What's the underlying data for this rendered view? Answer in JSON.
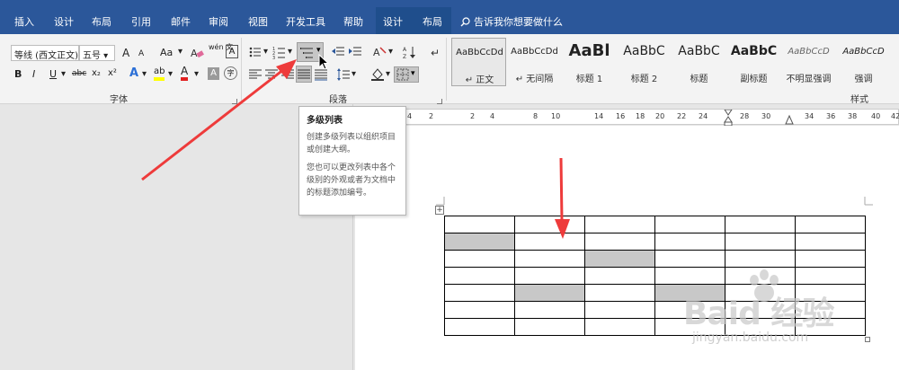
{
  "tabs": {
    "items": [
      "插入",
      "设计",
      "布局",
      "引用",
      "邮件",
      "审阅",
      "视图",
      "开发工具",
      "帮助"
    ],
    "context_items": [
      "设计",
      "布局"
    ],
    "tell_me": "告诉我你想要做什么"
  },
  "font_group": {
    "label": "字体",
    "font_name": "等线 (西文正文)",
    "font_size": "五号",
    "grow": "A",
    "shrink": "A",
    "change_case": "Aa",
    "clear_format": "",
    "phonetic": "wén 文",
    "border_char": "A",
    "bold": "B",
    "italic": "I",
    "underline": "U",
    "strike": "abc",
    "subscript": "x₂",
    "superscript": "x²",
    "text_effect": "A",
    "highlight": "ab",
    "font_color": "A",
    "char_shading": "A",
    "enclose": "字"
  },
  "paragraph_group": {
    "label": "段落"
  },
  "styles_group": {
    "label": "样式",
    "items": [
      {
        "sample": "AaBbCcDd",
        "name": "↵ 正文"
      },
      {
        "sample": "AaBbCcDd",
        "name": "↵ 无间隔"
      },
      {
        "sample": "AaBl",
        "name": "标题 1"
      },
      {
        "sample": "AaBbC",
        "name": "标题 2"
      },
      {
        "sample": "AaBbC",
        "name": "标题"
      },
      {
        "sample": "AaBbC",
        "name": "副标题"
      },
      {
        "sample": "AaBbCcD",
        "name": "不明显强调"
      },
      {
        "sample": "AaBbCcD",
        "name": "强调"
      }
    ]
  },
  "ruler": {
    "ticks": [
      "4",
      "2",
      "2",
      "4",
      "8",
      "10",
      "14",
      "16",
      "18",
      "20",
      "22",
      "24",
      "28",
      "30",
      "34",
      "36",
      "38",
      "40",
      "42"
    ]
  },
  "tooltip": {
    "title": "多级列表",
    "p1": "创建多级列表以组织项目或创建大纲。",
    "p2": "您也可以更改列表中各个级别的外观或者为文档中的标题添加编号。"
  },
  "table": {
    "rows": 7,
    "cols": 6,
    "gray_cells": [
      [
        1,
        0
      ],
      [
        2,
        2
      ],
      [
        4,
        1
      ],
      [
        4,
        3
      ]
    ]
  },
  "watermark": {
    "main": "Baid 经验",
    "url": "jingyan.baidu.com"
  },
  "colors": {
    "accent": "#2b579a",
    "arrow": "#ee3b3b",
    "highlight": "#ffff00",
    "font_color": "#e02020"
  }
}
